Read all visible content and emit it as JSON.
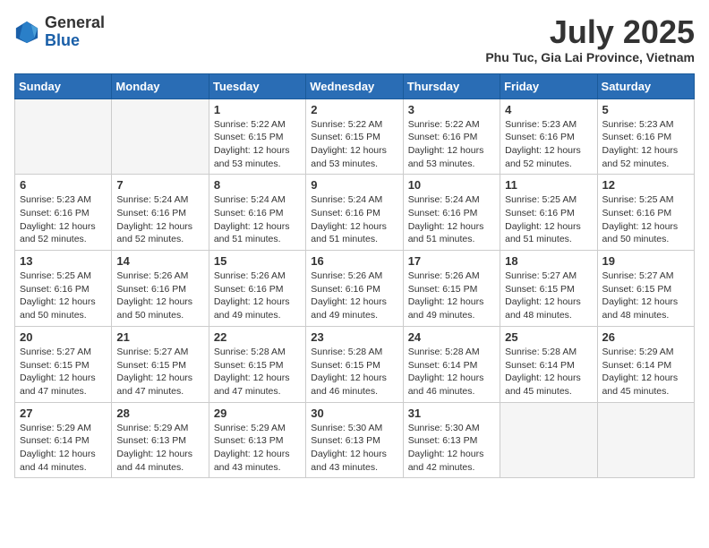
{
  "header": {
    "logo_line1": "General",
    "logo_line2": "Blue",
    "month_title": "July 2025",
    "location": "Phu Tuc, Gia Lai Province, Vietnam"
  },
  "days_of_week": [
    "Sunday",
    "Monday",
    "Tuesday",
    "Wednesday",
    "Thursday",
    "Friday",
    "Saturday"
  ],
  "weeks": [
    [
      {
        "day": "",
        "info": ""
      },
      {
        "day": "",
        "info": ""
      },
      {
        "day": "1",
        "info": "Sunrise: 5:22 AM\nSunset: 6:15 PM\nDaylight: 12 hours and 53 minutes."
      },
      {
        "day": "2",
        "info": "Sunrise: 5:22 AM\nSunset: 6:15 PM\nDaylight: 12 hours and 53 minutes."
      },
      {
        "day": "3",
        "info": "Sunrise: 5:22 AM\nSunset: 6:16 PM\nDaylight: 12 hours and 53 minutes."
      },
      {
        "day": "4",
        "info": "Sunrise: 5:23 AM\nSunset: 6:16 PM\nDaylight: 12 hours and 52 minutes."
      },
      {
        "day": "5",
        "info": "Sunrise: 5:23 AM\nSunset: 6:16 PM\nDaylight: 12 hours and 52 minutes."
      }
    ],
    [
      {
        "day": "6",
        "info": "Sunrise: 5:23 AM\nSunset: 6:16 PM\nDaylight: 12 hours and 52 minutes."
      },
      {
        "day": "7",
        "info": "Sunrise: 5:24 AM\nSunset: 6:16 PM\nDaylight: 12 hours and 52 minutes."
      },
      {
        "day": "8",
        "info": "Sunrise: 5:24 AM\nSunset: 6:16 PM\nDaylight: 12 hours and 51 minutes."
      },
      {
        "day": "9",
        "info": "Sunrise: 5:24 AM\nSunset: 6:16 PM\nDaylight: 12 hours and 51 minutes."
      },
      {
        "day": "10",
        "info": "Sunrise: 5:24 AM\nSunset: 6:16 PM\nDaylight: 12 hours and 51 minutes."
      },
      {
        "day": "11",
        "info": "Sunrise: 5:25 AM\nSunset: 6:16 PM\nDaylight: 12 hours and 51 minutes."
      },
      {
        "day": "12",
        "info": "Sunrise: 5:25 AM\nSunset: 6:16 PM\nDaylight: 12 hours and 50 minutes."
      }
    ],
    [
      {
        "day": "13",
        "info": "Sunrise: 5:25 AM\nSunset: 6:16 PM\nDaylight: 12 hours and 50 minutes."
      },
      {
        "day": "14",
        "info": "Sunrise: 5:26 AM\nSunset: 6:16 PM\nDaylight: 12 hours and 50 minutes."
      },
      {
        "day": "15",
        "info": "Sunrise: 5:26 AM\nSunset: 6:16 PM\nDaylight: 12 hours and 49 minutes."
      },
      {
        "day": "16",
        "info": "Sunrise: 5:26 AM\nSunset: 6:16 PM\nDaylight: 12 hours and 49 minutes."
      },
      {
        "day": "17",
        "info": "Sunrise: 5:26 AM\nSunset: 6:15 PM\nDaylight: 12 hours and 49 minutes."
      },
      {
        "day": "18",
        "info": "Sunrise: 5:27 AM\nSunset: 6:15 PM\nDaylight: 12 hours and 48 minutes."
      },
      {
        "day": "19",
        "info": "Sunrise: 5:27 AM\nSunset: 6:15 PM\nDaylight: 12 hours and 48 minutes."
      }
    ],
    [
      {
        "day": "20",
        "info": "Sunrise: 5:27 AM\nSunset: 6:15 PM\nDaylight: 12 hours and 47 minutes."
      },
      {
        "day": "21",
        "info": "Sunrise: 5:27 AM\nSunset: 6:15 PM\nDaylight: 12 hours and 47 minutes."
      },
      {
        "day": "22",
        "info": "Sunrise: 5:28 AM\nSunset: 6:15 PM\nDaylight: 12 hours and 47 minutes."
      },
      {
        "day": "23",
        "info": "Sunrise: 5:28 AM\nSunset: 6:15 PM\nDaylight: 12 hours and 46 minutes."
      },
      {
        "day": "24",
        "info": "Sunrise: 5:28 AM\nSunset: 6:14 PM\nDaylight: 12 hours and 46 minutes."
      },
      {
        "day": "25",
        "info": "Sunrise: 5:28 AM\nSunset: 6:14 PM\nDaylight: 12 hours and 45 minutes."
      },
      {
        "day": "26",
        "info": "Sunrise: 5:29 AM\nSunset: 6:14 PM\nDaylight: 12 hours and 45 minutes."
      }
    ],
    [
      {
        "day": "27",
        "info": "Sunrise: 5:29 AM\nSunset: 6:14 PM\nDaylight: 12 hours and 44 minutes."
      },
      {
        "day": "28",
        "info": "Sunrise: 5:29 AM\nSunset: 6:13 PM\nDaylight: 12 hours and 44 minutes."
      },
      {
        "day": "29",
        "info": "Sunrise: 5:29 AM\nSunset: 6:13 PM\nDaylight: 12 hours and 43 minutes."
      },
      {
        "day": "30",
        "info": "Sunrise: 5:30 AM\nSunset: 6:13 PM\nDaylight: 12 hours and 43 minutes."
      },
      {
        "day": "31",
        "info": "Sunrise: 5:30 AM\nSunset: 6:13 PM\nDaylight: 12 hours and 42 minutes."
      },
      {
        "day": "",
        "info": ""
      },
      {
        "day": "",
        "info": ""
      }
    ]
  ]
}
